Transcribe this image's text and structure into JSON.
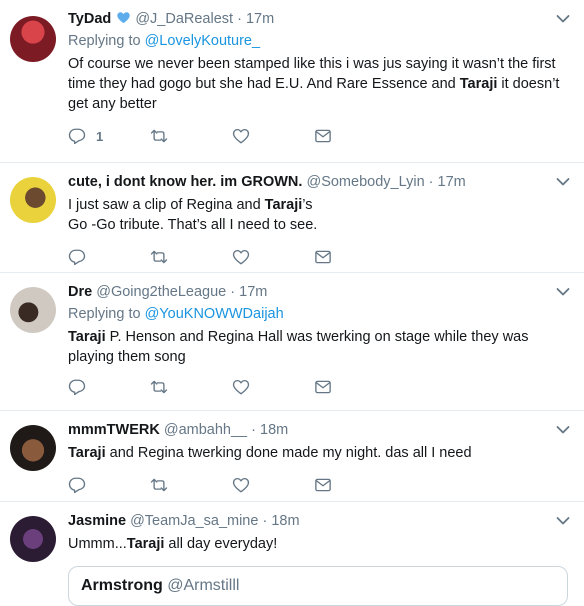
{
  "tweets": [
    {
      "name": "TyDad",
      "handle": "@J_DaRealest",
      "time": "17m",
      "verified_badge": "blue-heart-emoji",
      "replying_prefix": "Replying to",
      "replying_handle": "@LovelyKouture_",
      "text_parts": [
        "Of course we never been stamped like this i was jus saying it wasn’t the first time they had gogo but she had E.U. And Rare Essence and ",
        "Taraji",
        " it doesn’t get any better"
      ],
      "reply_count": "1"
    },
    {
      "name": "cute, i dont know her. im GROWN.",
      "handle": "@Somebody_Lyin",
      "time": "17m",
      "text_parts": [
        "I just saw a clip of Regina and ",
        "Taraji",
        "’s",
        "Go -Go tribute. That’s all I need to see."
      ]
    },
    {
      "name": "Dre",
      "handle": "@Going2theLeague",
      "time": "17m",
      "replying_prefix": "Replying to",
      "replying_handle": "@YouKNOWWDaijah",
      "text_parts": [
        "Taraji",
        " P. Henson and Regina Hall was twerking on stage while they was playing them song"
      ]
    },
    {
      "name": "mmmTWERK",
      "handle": "@ambahh__",
      "time": "18m",
      "text_parts": [
        "Taraji",
        " and Regina twerking done made my night. das all I need"
      ]
    },
    {
      "name": "Jasmine",
      "handle": "@TeamJa_sa_mine",
      "time": "18m",
      "text_parts": [
        "Ummm...",
        "Taraji",
        " all day everyday!"
      ],
      "quote": {
        "name": "Armstrong",
        "handle": "@Armstilll"
      }
    }
  ],
  "colors": {
    "link": "#1b95e0",
    "muted": "#657786",
    "divider": "#e6ecf0"
  },
  "icons": [
    "reply-icon",
    "retweet-icon",
    "like-icon",
    "dm-icon",
    "caret-down-icon"
  ]
}
